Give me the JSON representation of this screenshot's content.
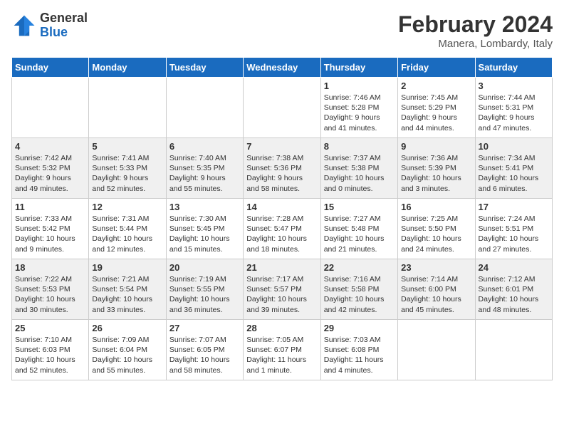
{
  "header": {
    "logo_general": "General",
    "logo_blue": "Blue",
    "title": "February 2024",
    "subtitle": "Manera, Lombardy, Italy"
  },
  "days_of_week": [
    "Sunday",
    "Monday",
    "Tuesday",
    "Wednesday",
    "Thursday",
    "Friday",
    "Saturday"
  ],
  "weeks": [
    [
      {
        "day": "",
        "info": ""
      },
      {
        "day": "",
        "info": ""
      },
      {
        "day": "",
        "info": ""
      },
      {
        "day": "",
        "info": ""
      },
      {
        "day": "1",
        "info": "Sunrise: 7:46 AM\nSunset: 5:28 PM\nDaylight: 9 hours\nand 41 minutes."
      },
      {
        "day": "2",
        "info": "Sunrise: 7:45 AM\nSunset: 5:29 PM\nDaylight: 9 hours\nand 44 minutes."
      },
      {
        "day": "3",
        "info": "Sunrise: 7:44 AM\nSunset: 5:31 PM\nDaylight: 9 hours\nand 47 minutes."
      }
    ],
    [
      {
        "day": "4",
        "info": "Sunrise: 7:42 AM\nSunset: 5:32 PM\nDaylight: 9 hours\nand 49 minutes."
      },
      {
        "day": "5",
        "info": "Sunrise: 7:41 AM\nSunset: 5:33 PM\nDaylight: 9 hours\nand 52 minutes."
      },
      {
        "day": "6",
        "info": "Sunrise: 7:40 AM\nSunset: 5:35 PM\nDaylight: 9 hours\nand 55 minutes."
      },
      {
        "day": "7",
        "info": "Sunrise: 7:38 AM\nSunset: 5:36 PM\nDaylight: 9 hours\nand 58 minutes."
      },
      {
        "day": "8",
        "info": "Sunrise: 7:37 AM\nSunset: 5:38 PM\nDaylight: 10 hours\nand 0 minutes."
      },
      {
        "day": "9",
        "info": "Sunrise: 7:36 AM\nSunset: 5:39 PM\nDaylight: 10 hours\nand 3 minutes."
      },
      {
        "day": "10",
        "info": "Sunrise: 7:34 AM\nSunset: 5:41 PM\nDaylight: 10 hours\nand 6 minutes."
      }
    ],
    [
      {
        "day": "11",
        "info": "Sunrise: 7:33 AM\nSunset: 5:42 PM\nDaylight: 10 hours\nand 9 minutes."
      },
      {
        "day": "12",
        "info": "Sunrise: 7:31 AM\nSunset: 5:44 PM\nDaylight: 10 hours\nand 12 minutes."
      },
      {
        "day": "13",
        "info": "Sunrise: 7:30 AM\nSunset: 5:45 PM\nDaylight: 10 hours\nand 15 minutes."
      },
      {
        "day": "14",
        "info": "Sunrise: 7:28 AM\nSunset: 5:47 PM\nDaylight: 10 hours\nand 18 minutes."
      },
      {
        "day": "15",
        "info": "Sunrise: 7:27 AM\nSunset: 5:48 PM\nDaylight: 10 hours\nand 21 minutes."
      },
      {
        "day": "16",
        "info": "Sunrise: 7:25 AM\nSunset: 5:50 PM\nDaylight: 10 hours\nand 24 minutes."
      },
      {
        "day": "17",
        "info": "Sunrise: 7:24 AM\nSunset: 5:51 PM\nDaylight: 10 hours\nand 27 minutes."
      }
    ],
    [
      {
        "day": "18",
        "info": "Sunrise: 7:22 AM\nSunset: 5:53 PM\nDaylight: 10 hours\nand 30 minutes."
      },
      {
        "day": "19",
        "info": "Sunrise: 7:21 AM\nSunset: 5:54 PM\nDaylight: 10 hours\nand 33 minutes."
      },
      {
        "day": "20",
        "info": "Sunrise: 7:19 AM\nSunset: 5:55 PM\nDaylight: 10 hours\nand 36 minutes."
      },
      {
        "day": "21",
        "info": "Sunrise: 7:17 AM\nSunset: 5:57 PM\nDaylight: 10 hours\nand 39 minutes."
      },
      {
        "day": "22",
        "info": "Sunrise: 7:16 AM\nSunset: 5:58 PM\nDaylight: 10 hours\nand 42 minutes."
      },
      {
        "day": "23",
        "info": "Sunrise: 7:14 AM\nSunset: 6:00 PM\nDaylight: 10 hours\nand 45 minutes."
      },
      {
        "day": "24",
        "info": "Sunrise: 7:12 AM\nSunset: 6:01 PM\nDaylight: 10 hours\nand 48 minutes."
      }
    ],
    [
      {
        "day": "25",
        "info": "Sunrise: 7:10 AM\nSunset: 6:03 PM\nDaylight: 10 hours\nand 52 minutes."
      },
      {
        "day": "26",
        "info": "Sunrise: 7:09 AM\nSunset: 6:04 PM\nDaylight: 10 hours\nand 55 minutes."
      },
      {
        "day": "27",
        "info": "Sunrise: 7:07 AM\nSunset: 6:05 PM\nDaylight: 10 hours\nand 58 minutes."
      },
      {
        "day": "28",
        "info": "Sunrise: 7:05 AM\nSunset: 6:07 PM\nDaylight: 11 hours\nand 1 minute."
      },
      {
        "day": "29",
        "info": "Sunrise: 7:03 AM\nSunset: 6:08 PM\nDaylight: 11 hours\nand 4 minutes."
      },
      {
        "day": "",
        "info": ""
      },
      {
        "day": "",
        "info": ""
      }
    ]
  ]
}
